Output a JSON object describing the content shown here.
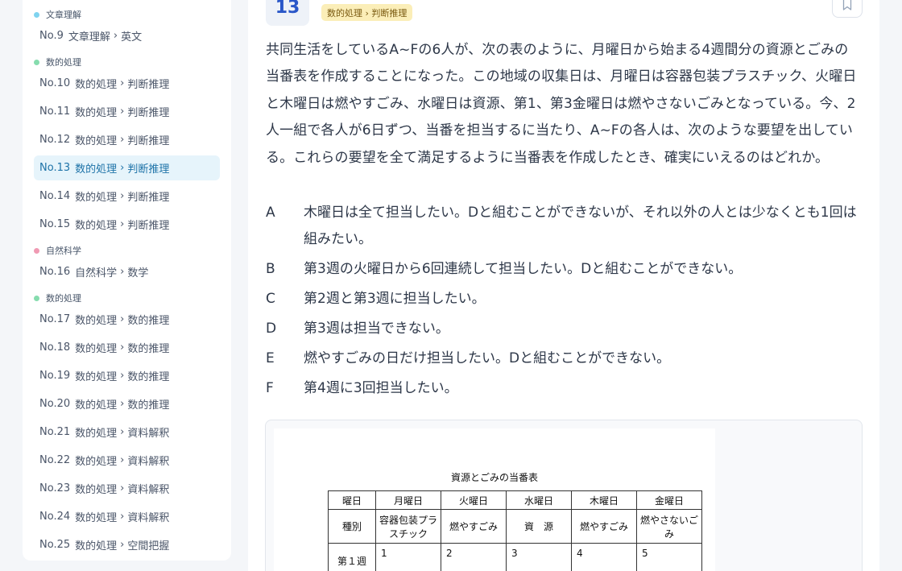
{
  "sidebar": {
    "groups": [
      {
        "label": "文章理解",
        "color": "#7fd3ef",
        "items": [
          {
            "num": "No.9",
            "cat": "文章理解",
            "sub": "英文",
            "active": false
          }
        ]
      },
      {
        "label": "数的処理",
        "color": "#86dcae",
        "items": [
          {
            "num": "No.10",
            "cat": "数的処理",
            "sub": "判断推理",
            "active": false
          },
          {
            "num": "No.11",
            "cat": "数的処理",
            "sub": "判断推理",
            "active": false
          },
          {
            "num": "No.12",
            "cat": "数的処理",
            "sub": "判断推理",
            "active": false
          },
          {
            "num": "No.13",
            "cat": "数的処理",
            "sub": "判断推理",
            "active": true
          },
          {
            "num": "No.14",
            "cat": "数的処理",
            "sub": "判断推理",
            "active": false
          },
          {
            "num": "No.15",
            "cat": "数的処理",
            "sub": "判断推理",
            "active": false
          }
        ]
      },
      {
        "label": "自然科学",
        "color": "#f09ab3",
        "items": [
          {
            "num": "No.16",
            "cat": "自然科学",
            "sub": "数学",
            "active": false
          }
        ]
      },
      {
        "label": "数的処理",
        "color": "#86dcae",
        "items": [
          {
            "num": "No.17",
            "cat": "数的処理",
            "sub": "数的推理",
            "active": false
          },
          {
            "num": "No.18",
            "cat": "数的処理",
            "sub": "数的推理",
            "active": false
          },
          {
            "num": "No.19",
            "cat": "数的処理",
            "sub": "数的推理",
            "active": false
          },
          {
            "num": "No.20",
            "cat": "数的処理",
            "sub": "数的推理",
            "active": false
          },
          {
            "num": "No.21",
            "cat": "数的処理",
            "sub": "資料解釈",
            "active": false
          },
          {
            "num": "No.22",
            "cat": "数的処理",
            "sub": "資料解釈",
            "active": false
          },
          {
            "num": "No.23",
            "cat": "数的処理",
            "sub": "資料解釈",
            "active": false
          },
          {
            "num": "No.24",
            "cat": "数的処理",
            "sub": "資料解釈",
            "active": false
          },
          {
            "num": "No.25",
            "cat": "数的処理",
            "sub": "空間把握",
            "active": false
          }
        ]
      }
    ]
  },
  "question": {
    "number": "13",
    "tag": "数的処理 › 判断推理",
    "bookmark_icon": "bookmark-icon",
    "text": "共同生活をしているA~Fの6人が、次の表のように、月曜日から始まる4週間分の資源とごみの当番表を作成することになった。この地域の収集日は、月曜日は容器包装プラスチック、火曜日と木曜日は燃やすごみ、水曜日は資源、第1、第3金曜日は燃やさないごみとなっている。今、2人一組で各人が6日ずつ、当番を担当するに当たり、A~Fの各人は、次のような要望を出している。これらの要望を全て満足するように当番表を作成したとき、確実にいえるのはどれか。",
    "options": [
      {
        "letter": "A",
        "text": "木曜日は全て担当したい。Dと組むことができないが、それ以外の人とは少なくとも1回は組みたい。"
      },
      {
        "letter": "B",
        "text": "第3週の火曜日から6回連続して担当したい。Dと組むことができない。"
      },
      {
        "letter": "C",
        "text": "第2週と第3週に担当したい。"
      },
      {
        "letter": "D",
        "text": "第3週は担当できない。"
      },
      {
        "letter": "E",
        "text": "燃やすごみの日だけ担当したい。Dと組むことができない。"
      },
      {
        "letter": "F",
        "text": "第4週に3回担当したい。"
      }
    ]
  },
  "figure": {
    "title": "資源とごみの当番表",
    "header": [
      "曜日",
      "月曜日",
      "火曜日",
      "水曜日",
      "木曜日",
      "金曜日"
    ],
    "types": [
      "種別",
      "容器包装プラスチック",
      "燃やすごみ",
      "資　源",
      "燃やすごみ",
      "燃やさないごみ"
    ],
    "week1": [
      "第１週",
      "1",
      "2",
      "3",
      "4",
      "5"
    ]
  }
}
